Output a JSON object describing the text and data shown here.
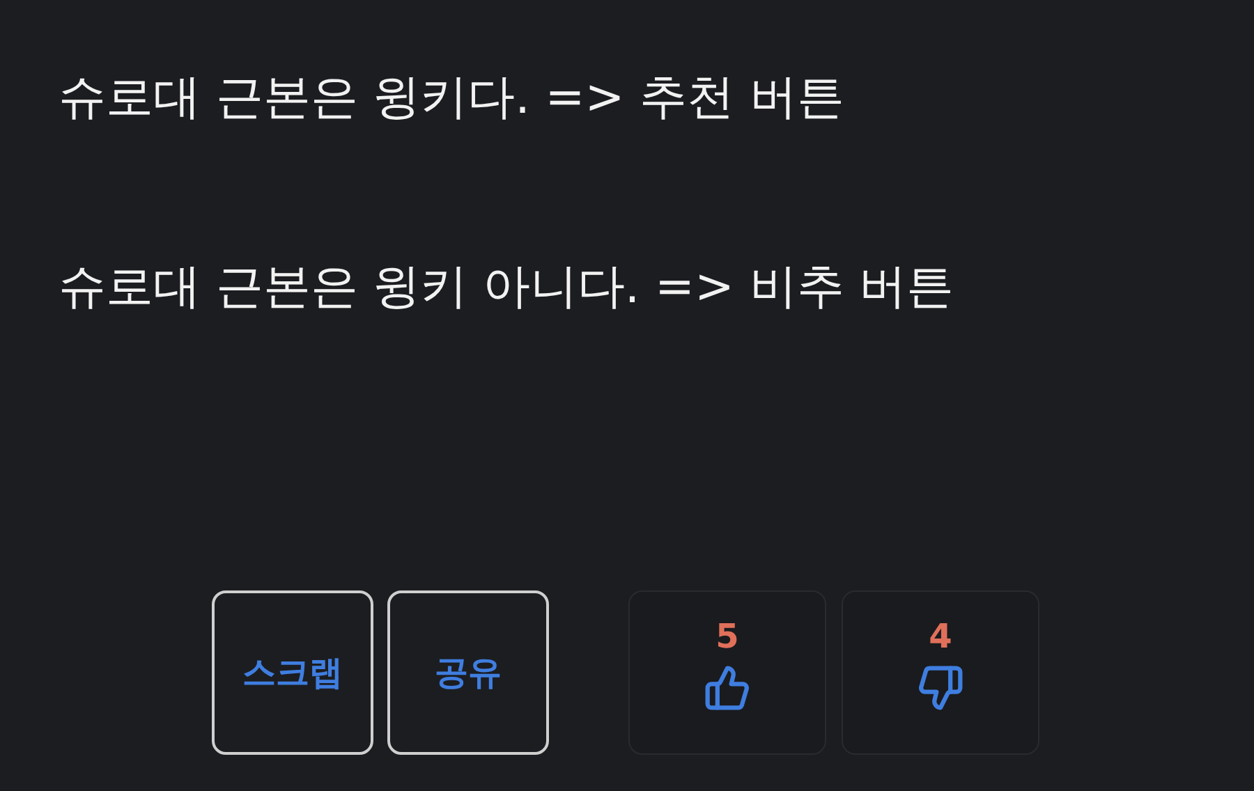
{
  "paragraphs": [
    "슈로대 근본은 윙키다. => 추천 버튼",
    "슈로대 근본은 윙키 아니다. => 비추 버튼"
  ],
  "actions": [
    {
      "label": "스크랩"
    },
    {
      "label": "공유"
    }
  ],
  "votes": [
    {
      "kind": "up",
      "count": "5"
    },
    {
      "kind": "down",
      "count": "4"
    }
  ]
}
